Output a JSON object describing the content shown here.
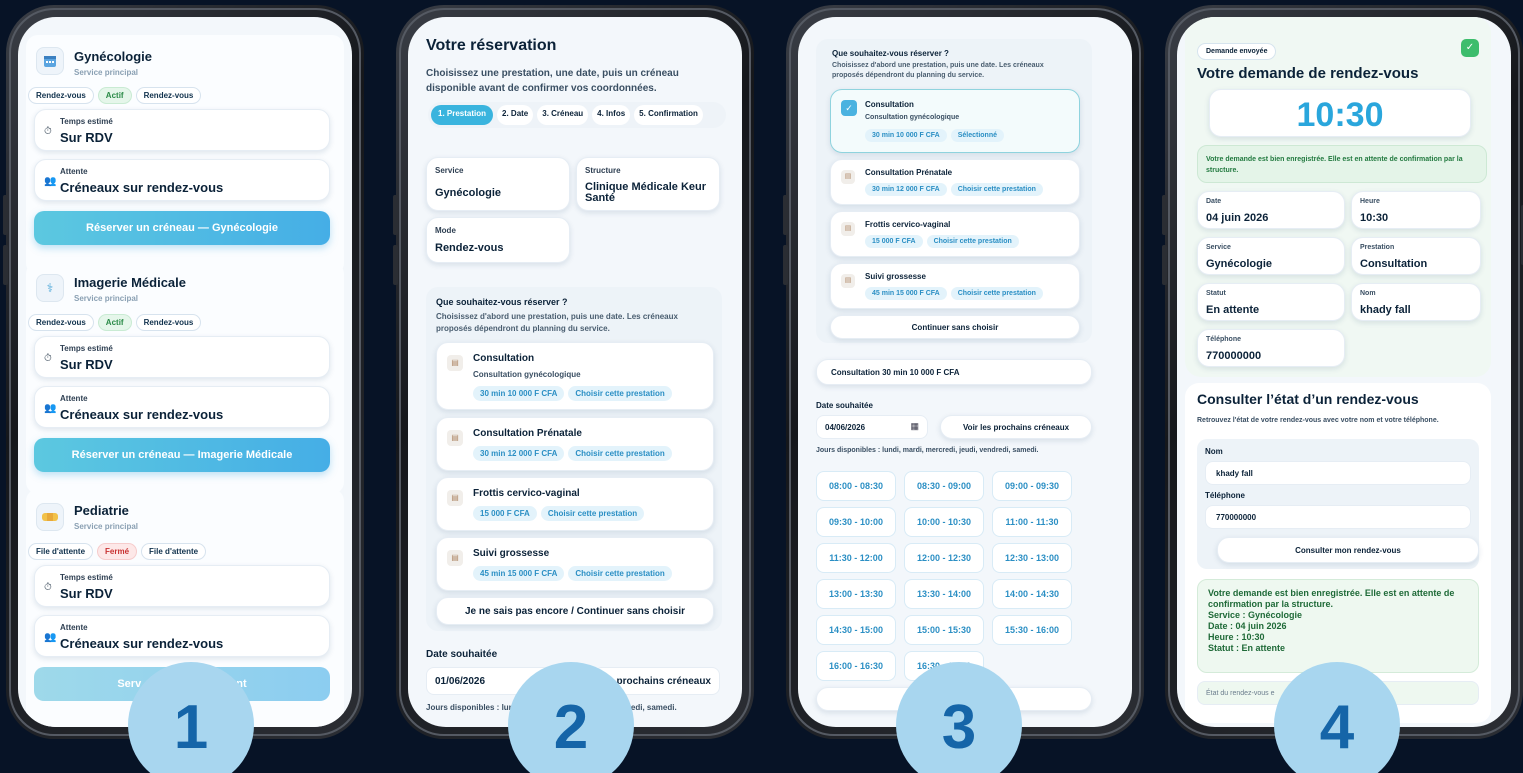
{
  "phone1": {
    "services": [
      {
        "title": "Gynécologie",
        "subtitle": "Service principal",
        "icon": "calendar-icon",
        "pills": [
          "Rendez-vous",
          "Actif",
          "Rendez-vous"
        ],
        "time_label": "Temps estimé",
        "time_value": "Sur RDV",
        "wait_label": "Attente",
        "wait_value": "Créneaux sur rendez-vous",
        "button": "Réserver un créneau — Gynécologie"
      },
      {
        "title": "Imagerie Médicale",
        "subtitle": "Service principal",
        "icon": "syringe-icon",
        "pills": [
          "Rendez-vous",
          "Actif",
          "Rendez-vous"
        ],
        "time_label": "Temps estimé",
        "time_value": "Sur RDV",
        "wait_label": "Attente",
        "wait_value": "Créneaux sur rendez-vous",
        "button": "Réserver un créneau — Imagerie Médicale"
      },
      {
        "title": "Pediatrie",
        "subtitle": "Service principal",
        "icon": "bandage-icon",
        "pills": [
          "File d'attente",
          "Fermé",
          "File d'attente"
        ],
        "time_label": "Temps estimé",
        "time_value": "Sur RDV",
        "wait_label": "Attente",
        "wait_value": "Créneaux sur rendez-vous",
        "button": "Serv ement"
      }
    ]
  },
  "phone2": {
    "title": "Votre réservation",
    "intro": "Choisissez une prestation, une date, puis un créneau disponible avant de confirmer vos coordonnées.",
    "steps": [
      "1. Prestation",
      "2. Date",
      "3. Créneau",
      "4. Infos",
      "5. Confirmation"
    ],
    "service_label": "Service",
    "service_value": "Gynécologie",
    "structure_label": "Structure",
    "structure_value": "Clinique Médicale Keur Santé",
    "mode_label": "Mode",
    "mode_value": "Rendez-vous",
    "question": "Que souhaitez-vous réserver ?",
    "question_help": "Choisissez d'abord une prestation, puis une date. Les créneaux proposés dépendront du planning du service.",
    "prestations": [
      {
        "name": "Consultation",
        "desc": "Consultation gynécologique",
        "tags": [
          "30 min 10 000 F CFA",
          "Choisir cette prestation"
        ]
      },
      {
        "name": "Consultation Prénatale",
        "desc": "",
        "tags": [
          "30 min 12 000 F CFA",
          "Choisir cette prestation"
        ]
      },
      {
        "name": "Frottis cervico-vaginal",
        "desc": "",
        "tags": [
          "15 000 F CFA",
          "Choisir cette prestation"
        ]
      },
      {
        "name": "Suivi grossesse",
        "desc": "",
        "tags": [
          "45 min 15 000 F CFA",
          "Choisir cette prestation"
        ]
      }
    ],
    "skip": "Je ne sais pas encore / Continuer sans choisir",
    "date_label": "Date souhaitée",
    "date_value": "01/06/2026",
    "next_slots": "les prochains créneaux",
    "available": "Jours disponibles : lun",
    "available_end": "ndredi, samedi."
  },
  "phone3": {
    "question": "Que souhaitez-vous réserver ?",
    "question_help": "Choisissez d'abord une prestation, puis une date. Les créneaux proposés dépendront du planning du service.",
    "prestations": [
      {
        "name": "Consultation",
        "desc": "Consultation gynécologique",
        "tags": [
          "30 min 10 000 F CFA",
          "Sélectionné"
        ],
        "selected": true
      },
      {
        "name": "Consultation Prénatale",
        "desc": "",
        "tags": [
          "30 min 12 000 F CFA",
          "Choisir cette prestation"
        ]
      },
      {
        "name": "Frottis cervico-vaginal",
        "desc": "",
        "tags": [
          "15 000 F CFA",
          "Choisir cette prestation"
        ]
      },
      {
        "name": "Suivi grossesse",
        "desc": "",
        "tags": [
          "45 min 15 000 F CFA",
          "Choisir cette prestation"
        ]
      }
    ],
    "skip": "Continuer sans choisir",
    "summary": "Consultation 30 min 10 000 F CFA",
    "date_label": "Date souhaitée",
    "date_value": "04/06/2026",
    "next_slots": "Voir les prochains créneaux",
    "available": "Jours disponibles : lundi, mardi, mercredi, jeudi, vendredi, samedi.",
    "slots": [
      "08:00 - 08:30",
      "08:30 - 09:00",
      "09:00 - 09:30",
      "09:30 - 10:00",
      "10:00 - 10:30",
      "11:00 - 11:30",
      "11:30 - 12:00",
      "12:00 - 12:30",
      "12:30 - 13:00",
      "13:00 - 13:30",
      "13:30 - 14:00",
      "14:00 - 14:30",
      "14:30 - 15:00",
      "15:00 - 15:30",
      "15:30 - 16:00",
      "16:00 - 16:30",
      "16:30 - 17:00"
    ]
  },
  "phone4": {
    "badge": "Demande envoyée",
    "title": "Votre demande de rendez-vous",
    "time": "10:30",
    "notice": "Votre demande est bien enregistrée. Elle est en attente de confirmation par la structure.",
    "fields": [
      {
        "label": "Date",
        "value": "04 juin 2026"
      },
      {
        "label": "Heure",
        "value": "10:30"
      },
      {
        "label": "Service",
        "value": "Gynécologie"
      },
      {
        "label": "Prestation",
        "value": "Consultation"
      },
      {
        "label": "Statut",
        "value": "En attente"
      },
      {
        "label": "Nom",
        "value": "khady fall"
      },
      {
        "label": "Téléphone",
        "value": "770000000"
      }
    ],
    "check_title": "Consulter l’état d’un rendez-vous",
    "check_help": "Retrouvez l'état de votre rendez-vous avec votre nom et votre téléphone.",
    "name_label": "Nom",
    "name_value": "khady fall",
    "phone_label": "Téléphone",
    "phone_value": "770000000",
    "check_button": "Consulter mon rendez-vous",
    "result_lines": [
      "Votre demande est bien enregistrée. Elle est en attente de confirmation par la structure.",
      "Service : Gynécologie",
      "Date : 04 juin 2026",
      "Heure : 10:30",
      "Statut : En attente"
    ],
    "state_placeholder": "État du rendez-vous e"
  },
  "steps_numbers": [
    "1",
    "2",
    "3",
    "4"
  ],
  "colors": {
    "background": "#071326",
    "accent": "#45aee6",
    "circle": "#a8d6ef",
    "circle_text": "#1565a8",
    "success": "#2a8a47"
  }
}
